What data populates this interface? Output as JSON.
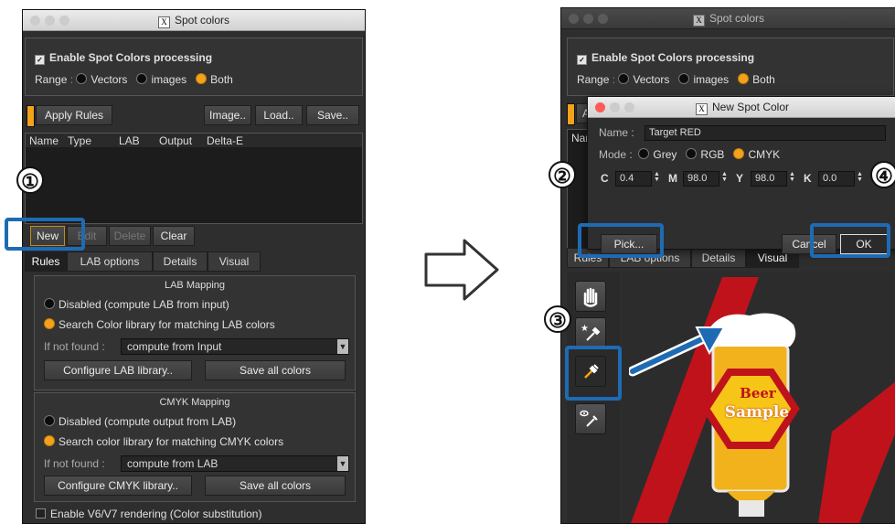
{
  "left": {
    "title": "Spot colors",
    "enable_label": "Enable Spot Colors processing",
    "range_label": "Range",
    "range_options": [
      "Vectors",
      "images",
      "Both"
    ],
    "apply_rules": "Apply Rules",
    "image_btn": "Image..",
    "load_btn": "Load..",
    "save_btn": "Save..",
    "columns": [
      "Name",
      "Type",
      "LAB",
      "Output",
      "Delta-E"
    ],
    "new_btn": "New",
    "edit_btn": "Edit",
    "delete_btn": "Delete",
    "clear_btn": "Clear",
    "tabs": [
      "Rules",
      "LAB options",
      "Details",
      "Visual"
    ],
    "lab_header": "LAB Mapping",
    "lab_opt1": "Disabled (compute LAB from input)",
    "lab_opt2": "Search Color library for matching LAB colors",
    "if_not_found": "If not found",
    "lab_combo": "compute from Input",
    "configure_lab": "Configure LAB library..",
    "save_all": "Save all colors",
    "cmyk_header": "CMYK Mapping",
    "cmyk_opt1": "Disabled (compute output from LAB)",
    "cmyk_opt2": "Search color library for matching CMYK colors",
    "cmyk_combo": "compute from LAB",
    "configure_cmyk": "Configure CMYK library..",
    "enable_v6": "Enable V6/V7 rendering (Color substitution)"
  },
  "right": {
    "title": "Spot colors",
    "enable_label": "Enable Spot Colors processing",
    "range_label": "Range",
    "range_options": [
      "Vectors",
      "images",
      "Both"
    ],
    "dialog_title": "New Spot Color",
    "name_label": "Name",
    "name_value": "Target RED",
    "mode_label": "Mode",
    "mode_options": [
      "Grey",
      "RGB",
      "CMYK"
    ],
    "c_label": "C",
    "c_value": "0.4",
    "m_label": "M",
    "m_value": "98.0",
    "y_label": "Y",
    "y_value": "98.0",
    "k_label": "K",
    "k_value": "0.0",
    "pick_btn": "Pick...",
    "cancel_btn": "Cancel",
    "ok_btn": "OK",
    "tabs": [
      "Rules",
      "LAB options",
      "Details",
      "Visual"
    ],
    "partial_a": "A",
    "partial_nam": "Nam",
    "partial_n": "N",
    "beer_text": "Beer",
    "sample_text": "Sample"
  },
  "callouts": [
    "①",
    "②",
    "③",
    "④"
  ],
  "colors": {
    "highlight": "#1e6bb4",
    "radio_on": "#f4a21a",
    "beer_red": "#c0121b",
    "beer_yellow": "#f6c517"
  }
}
